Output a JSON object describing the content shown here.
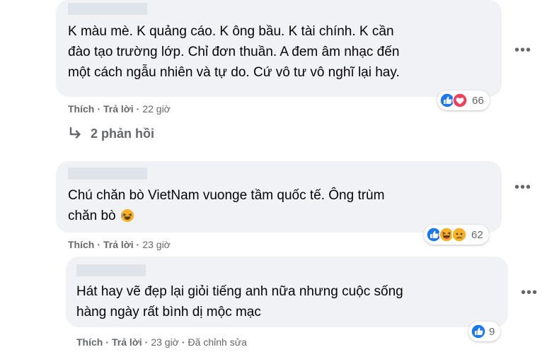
{
  "comments": [
    {
      "text": "K màu mè. K quảng cáo. K ông bầu. K tài chính. K cần\nđào tạo trường lớp. Chỉ đơn thuần. A đem âm nhạc đến\nmột cách ngẫu nhiên và tự do. Cứ vô tư vô nghĩ lại hay.",
      "reaction_icons": [
        "like-icon",
        "love-icon"
      ],
      "reaction_count": "66",
      "like": "Thích",
      "reply": "Trả lời",
      "time": "22 giờ"
    },
    {
      "text": "Chú chăn bò VietNam vuonge tầm quốc tế. Ông trùm\nchăn bò",
      "reaction_icons": [
        "like-icon",
        "haha-icon",
        "sad-icon"
      ],
      "reaction_count": "62",
      "like": "Thích",
      "reply": "Trả lời",
      "time": "23 giờ"
    },
    {
      "text": "Hát hay vẽ đẹp lại giỏi tiếng anh nữa nhưng cuộc sống\nhàng ngày rất bình dị mộc mạc",
      "reaction_icons": [
        "like-icon"
      ],
      "reaction_count": "9",
      "like": "Thích",
      "reply": "Trả lời",
      "time": "23 giờ",
      "edited": "Đã chỉnh sửa"
    }
  ],
  "replies_link": "2 phản hồi",
  "colors": {
    "bubble": "#f0f2f5",
    "secondary_text": "#65676b",
    "like_blue": "#1877f2",
    "love_red": "#f33e58",
    "haha_yellow": "#f7b125"
  }
}
